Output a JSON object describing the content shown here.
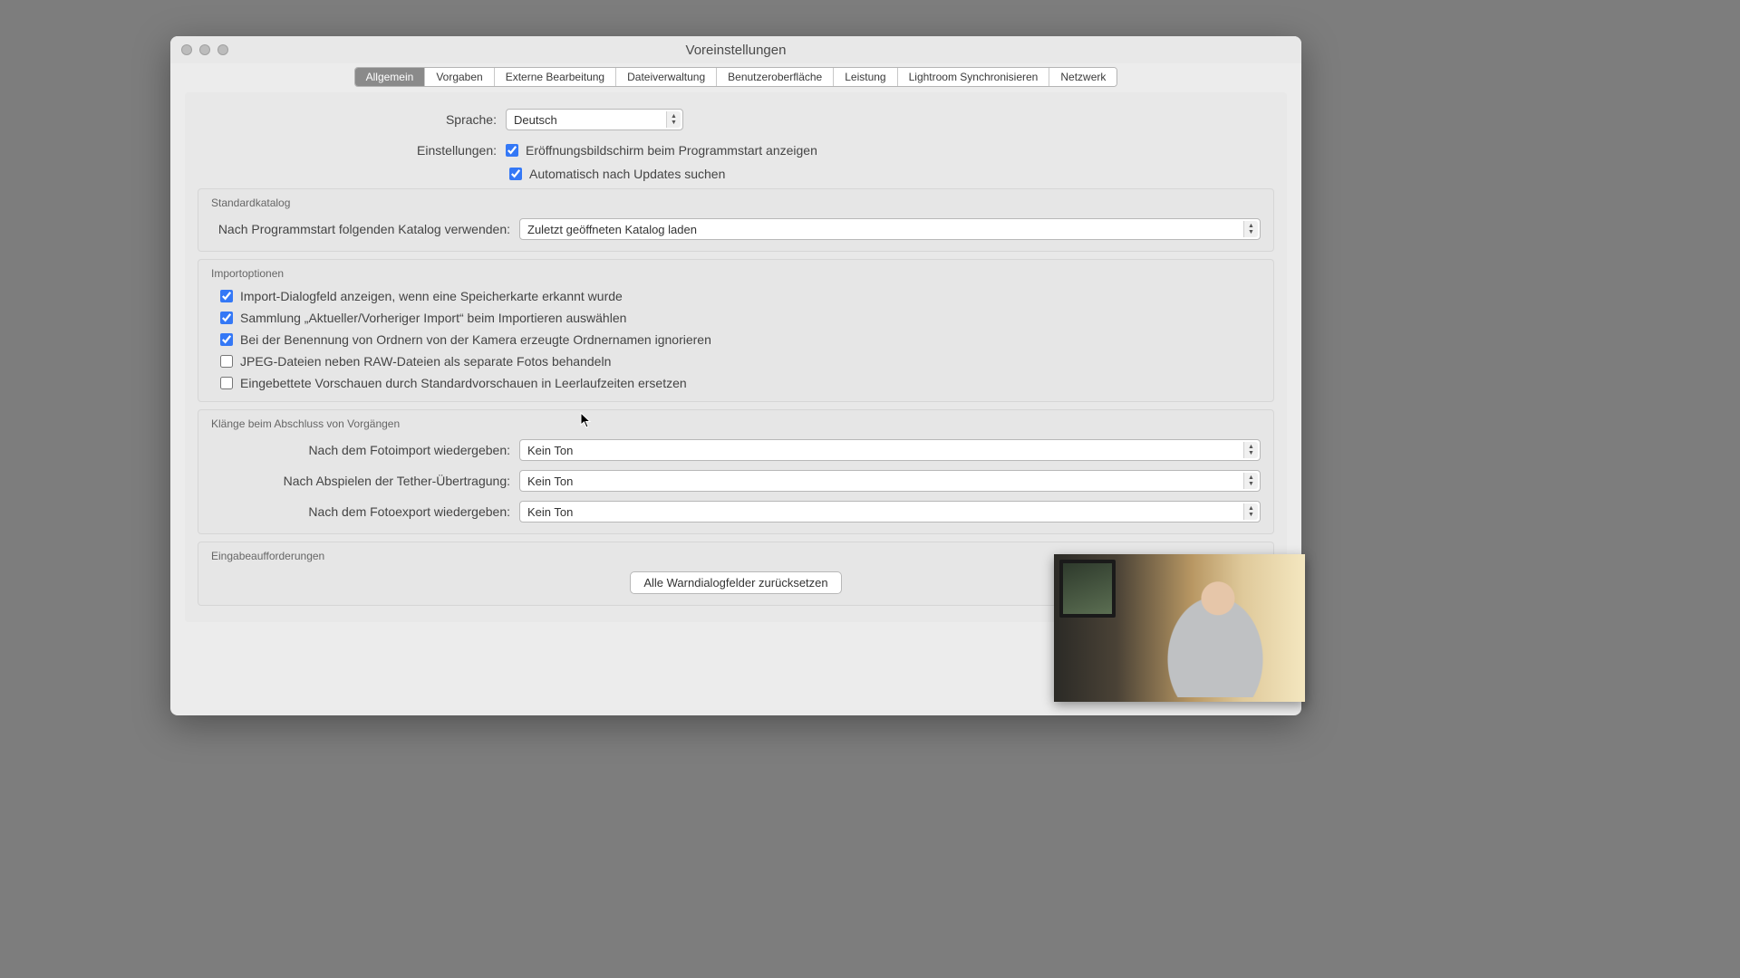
{
  "window": {
    "title": "Voreinstellungen"
  },
  "tabs": {
    "items": [
      "Allgemein",
      "Vorgaben",
      "Externe Bearbeitung",
      "Dateiverwaltung",
      "Benutzeroberfläche",
      "Leistung",
      "Lightroom Synchronisieren",
      "Netzwerk"
    ],
    "active_index": 0
  },
  "general": {
    "language_label": "Sprache:",
    "language_value": "Deutsch",
    "settings_label": "Einstellungen:",
    "show_splash": "Eröffnungsbildschirm beim Programmstart anzeigen",
    "auto_update": "Automatisch nach Updates suchen"
  },
  "catalog": {
    "group_title": "Standardkatalog",
    "label": "Nach Programmstart folgenden Katalog verwenden:",
    "value": "Zuletzt geöffneten Katalog laden"
  },
  "import": {
    "group_title": "Importoptionen",
    "opt1": "Import-Dialogfeld anzeigen, wenn eine Speicherkarte erkannt wurde",
    "opt2": "Sammlung „Aktueller/Vorheriger Import“ beim Importieren auswählen",
    "opt3": "Bei der Benennung von Ordnern von der Kamera erzeugte Ordnernamen ignorieren",
    "opt4": "JPEG-Dateien neben RAW-Dateien als separate Fotos behandeln",
    "opt5": "Eingebettete Vorschauen durch Standardvorschauen in Leerlaufzeiten ersetzen"
  },
  "sounds": {
    "group_title": "Klänge beim Abschluss von Vorgängen",
    "row1_label": "Nach dem Fotoimport wiedergeben:",
    "row1_value": "Kein Ton",
    "row2_label": "Nach Abspielen der Tether-Übertragung:",
    "row2_value": "Kein Ton",
    "row3_label": "Nach dem Fotoexport wiedergeben:",
    "row3_value": "Kein Ton"
  },
  "prompts": {
    "group_title": "Eingabeaufforderungen",
    "reset_button": "Alle Warndialogfelder zurücksetzen"
  }
}
